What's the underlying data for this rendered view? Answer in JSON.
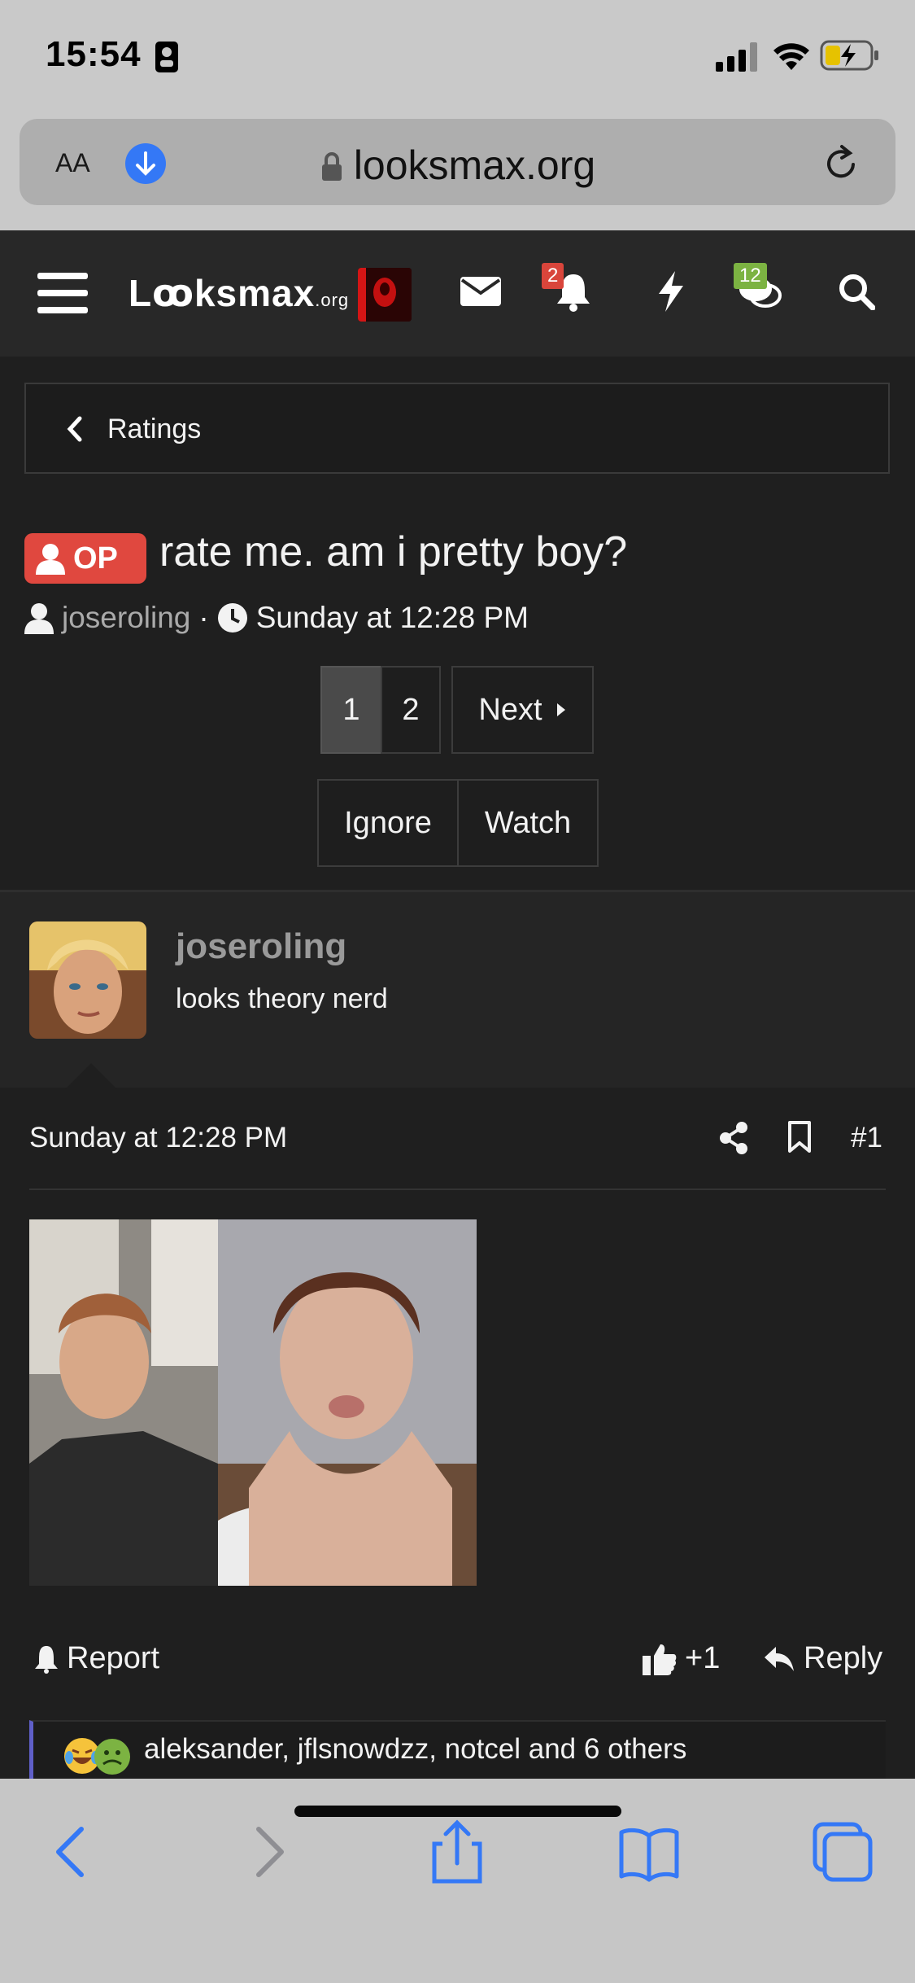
{
  "status_bar": {
    "time": "15:54"
  },
  "browser": {
    "text_size_label": "AA",
    "domain": "looksmax.org"
  },
  "site_header": {
    "logo_main": "Lꝏksmax",
    "logo_suffix": ".org",
    "alerts_count": "2",
    "conversations_count": "12"
  },
  "breadcrumb": {
    "label": "Ratings"
  },
  "thread": {
    "op_badge": "OP",
    "title": "rate me. am i pretty boy?",
    "author": "joseroling",
    "separator": "·",
    "date": "Sunday at 12:28 PM"
  },
  "pagination": {
    "pages": [
      "1",
      "2"
    ],
    "next_label": "Next",
    "current": "1"
  },
  "thread_actions": {
    "ignore": "Ignore",
    "watch": "Watch"
  },
  "post": {
    "author": "joseroling",
    "user_title": "looks theory nerd",
    "date": "Sunday at 12:28 PM",
    "number": "#1",
    "report": "Report",
    "like_count": "+1",
    "reply": "Reply",
    "reactions_text": "aleksander, jflsnowdzz, notcel and 6 others"
  },
  "colors": {
    "op_badge": "#e0483f",
    "alert_badge": "#d9453b",
    "conversation_badge": "#7cb342",
    "safari_blue": "#3478f6",
    "reaction_border": "#5f5fc8"
  },
  "icons": [
    "menu-icon",
    "envelope-icon",
    "bell-icon",
    "lightning-icon",
    "chat-icon",
    "search-icon",
    "back-chevron-icon",
    "user-icon",
    "clock-icon",
    "share-icon",
    "bookmark-icon",
    "thumbs-up-icon",
    "reply-icon",
    "back-icon",
    "forward-icon",
    "share-sheet-icon",
    "bookmarks-icon",
    "tabs-icon"
  ]
}
